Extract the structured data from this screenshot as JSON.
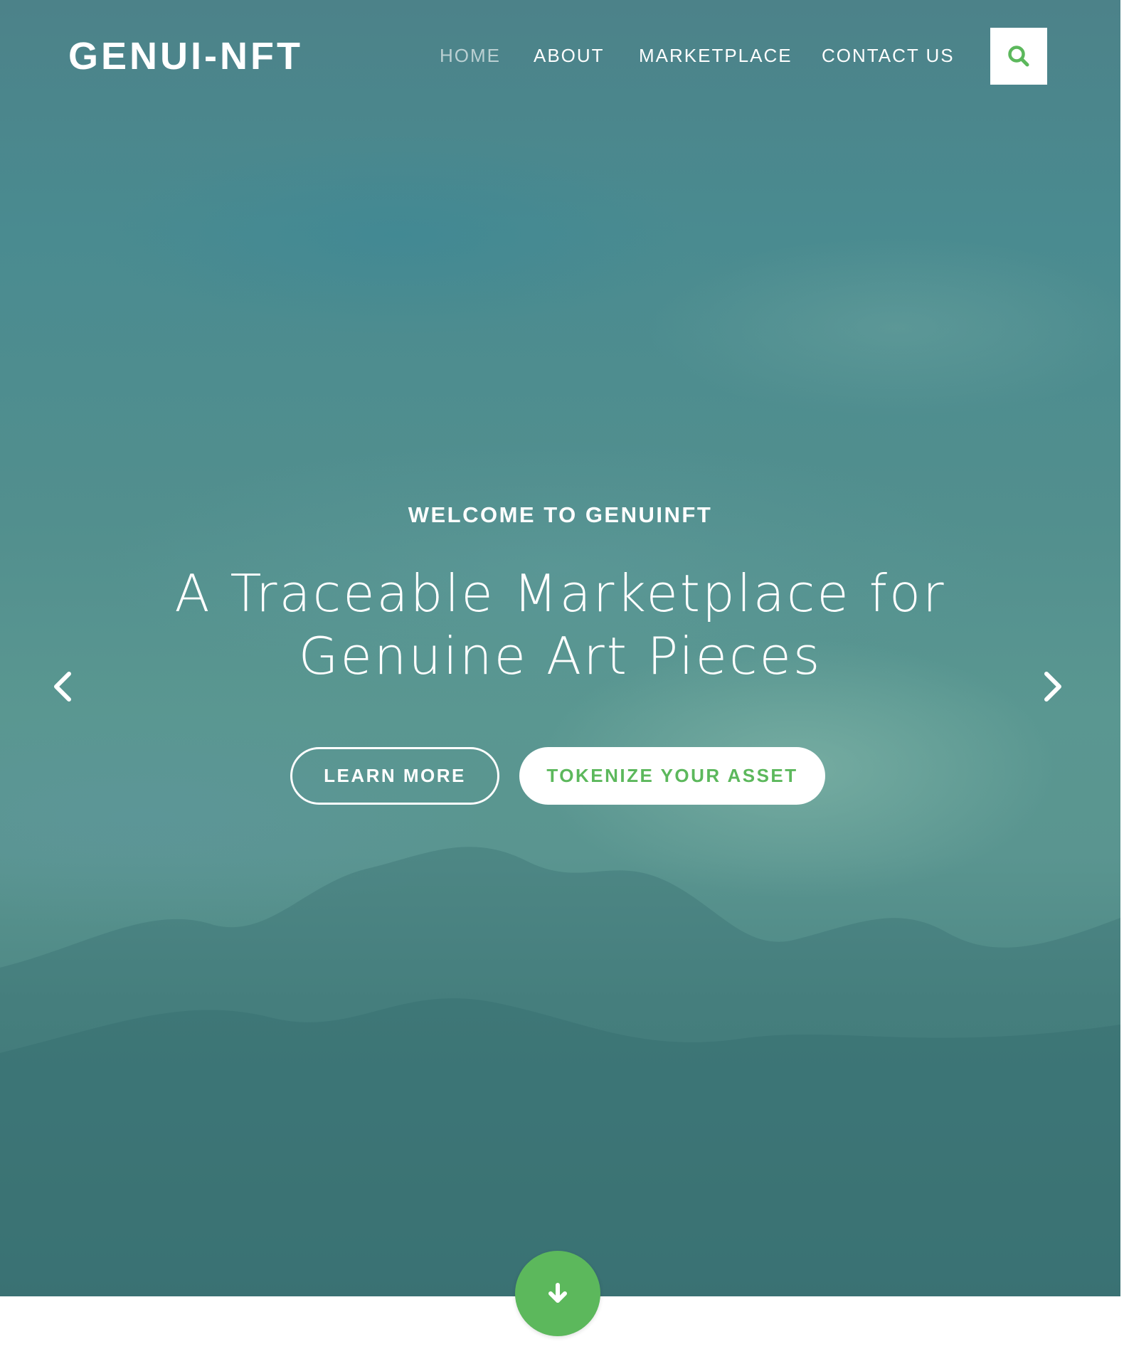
{
  "brand": {
    "name": "GENUI-NFT"
  },
  "nav": {
    "items": [
      {
        "label": "HOME",
        "active": true
      },
      {
        "label": "ABOUT",
        "active": false
      },
      {
        "label": "MARKETPLACE",
        "active": false
      },
      {
        "label": "CONTACT US",
        "active": false
      }
    ],
    "search_icon": "search-icon"
  },
  "hero": {
    "kicker": "WELCOME TO GENUINFT",
    "headline": "A Traceable Marketplace for Genuine Art Pieces",
    "buttons": {
      "learn_more": "LEARN MORE",
      "tokenize": "TOKENIZE YOUR ASSET"
    },
    "prev_icon": "chevron-left-icon",
    "next_icon": "chevron-right-icon"
  },
  "scroll": {
    "icon": "arrow-down-icon"
  },
  "colors": {
    "accent": "#5cb85c",
    "text": "#ffffff",
    "hero_tint": "#4f8a8b"
  }
}
